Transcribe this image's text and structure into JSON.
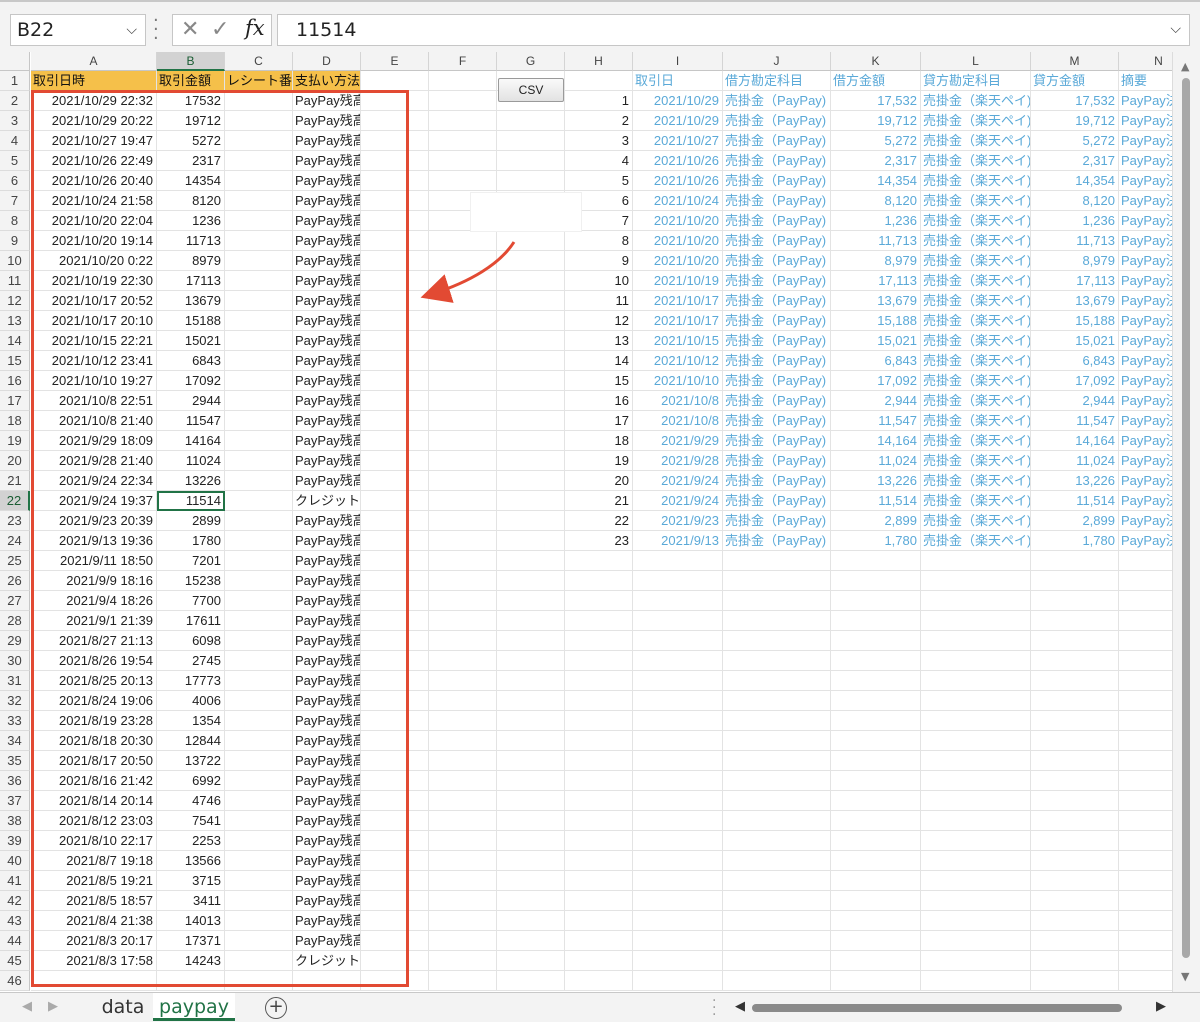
{
  "formula_bar": {
    "name_box": "B22",
    "cancel_glyph": "✕",
    "enter_glyph": "✓",
    "fx_label": "fx",
    "formula_value": "11514"
  },
  "columns": [
    "A",
    "B",
    "C",
    "D",
    "E",
    "F",
    "G",
    "H",
    "I",
    "J",
    "K",
    "L",
    "M",
    "N"
  ],
  "selected_column": "B",
  "row_numbers": [
    1,
    2,
    3,
    4,
    5,
    6,
    7,
    8,
    9,
    10,
    11,
    12,
    13,
    14,
    15,
    16,
    17,
    18,
    19,
    20,
    21,
    22,
    23,
    24,
    25,
    26,
    27,
    28,
    29,
    30,
    31,
    32,
    33,
    34,
    35,
    36,
    37,
    38,
    39,
    40,
    41,
    42,
    43,
    44,
    45,
    46
  ],
  "selected_row": 22,
  "left_table": {
    "headers": [
      "取引日時",
      "取引金額",
      "レシート番",
      "支払い方法"
    ],
    "rows": [
      [
        "2021/10/29 22:32",
        "17532",
        "",
        "PayPay残高"
      ],
      [
        "2021/10/29 20:22",
        "19712",
        "",
        "PayPay残高"
      ],
      [
        "2021/10/27 19:47",
        "5272",
        "",
        "PayPay残高"
      ],
      [
        "2021/10/26 22:49",
        "2317",
        "",
        "PayPay残高"
      ],
      [
        "2021/10/26 20:40",
        "14354",
        "",
        "PayPay残高"
      ],
      [
        "2021/10/24 21:58",
        "8120",
        "",
        "PayPay残高"
      ],
      [
        "2021/10/20 22:04",
        "1236",
        "",
        "PayPay残高"
      ],
      [
        "2021/10/20 19:14",
        "11713",
        "",
        "PayPay残高"
      ],
      [
        "2021/10/20 0:22",
        "8979",
        "",
        "PayPay残高"
      ],
      [
        "2021/10/19 22:30",
        "17113",
        "",
        "PayPay残高"
      ],
      [
        "2021/10/17 20:52",
        "13679",
        "",
        "PayPay残高"
      ],
      [
        "2021/10/17 20:10",
        "15188",
        "",
        "PayPay残高"
      ],
      [
        "2021/10/15 22:21",
        "15021",
        "",
        "PayPay残高"
      ],
      [
        "2021/10/12 23:41",
        "6843",
        "",
        "PayPay残高"
      ],
      [
        "2021/10/10 19:27",
        "17092",
        "",
        "PayPay残高"
      ],
      [
        "2021/10/8 22:51",
        "2944",
        "",
        "PayPay残高"
      ],
      [
        "2021/10/8 21:40",
        "11547",
        "",
        "PayPay残高"
      ],
      [
        "2021/9/29 18:09",
        "14164",
        "",
        "PayPay残高"
      ],
      [
        "2021/9/28 21:40",
        "11024",
        "",
        "PayPay残高"
      ],
      [
        "2021/9/24 22:34",
        "13226",
        "",
        "PayPay残高"
      ],
      [
        "2021/9/24 19:37",
        "11514",
        "",
        "クレジットカード"
      ],
      [
        "2021/9/23 20:39",
        "2899",
        "",
        "PayPay残高"
      ],
      [
        "2021/9/13 19:36",
        "1780",
        "",
        "PayPay残高"
      ],
      [
        "2021/9/11 18:50",
        "7201",
        "",
        "PayPay残高"
      ],
      [
        "2021/9/9 18:16",
        "15238",
        "",
        "PayPay残高"
      ],
      [
        "2021/9/4 18:26",
        "7700",
        "",
        "PayPay残高"
      ],
      [
        "2021/9/1 21:39",
        "17611",
        "",
        "PayPay残高"
      ],
      [
        "2021/8/27 21:13",
        "6098",
        "",
        "PayPay残高"
      ],
      [
        "2021/8/26 19:54",
        "2745",
        "",
        "PayPay残高"
      ],
      [
        "2021/8/25 20:13",
        "17773",
        "",
        "PayPay残高"
      ],
      [
        "2021/8/24 19:06",
        "4006",
        "",
        "PayPay残高"
      ],
      [
        "2021/8/19 23:28",
        "1354",
        "",
        "PayPay残高"
      ],
      [
        "2021/8/18 20:30",
        "12844",
        "",
        "PayPay残高"
      ],
      [
        "2021/8/17 20:50",
        "13722",
        "",
        "PayPay残高"
      ],
      [
        "2021/8/16 21:42",
        "6992",
        "",
        "PayPay残高"
      ],
      [
        "2021/8/14 20:14",
        "4746",
        "",
        "PayPay残高"
      ],
      [
        "2021/8/12 23:03",
        "7541",
        "",
        "PayPay残高"
      ],
      [
        "2021/8/10 22:17",
        "2253",
        "",
        "PayPay残高"
      ],
      [
        "2021/8/7 19:18",
        "13566",
        "",
        "PayPay残高"
      ],
      [
        "2021/8/5 19:21",
        "3715",
        "",
        "PayPay残高"
      ],
      [
        "2021/8/5 18:57",
        "3411",
        "",
        "PayPay残高"
      ],
      [
        "2021/8/4 21:38",
        "14013",
        "",
        "PayPay残高"
      ],
      [
        "2021/8/3 20:17",
        "17371",
        "",
        "PayPay残高"
      ],
      [
        "2021/8/3 17:58",
        "14243",
        "",
        "クレジットカード"
      ]
    ]
  },
  "csv_button_label": "CSV",
  "right_table": {
    "headers": [
      "",
      "取引日",
      "借方勘定科目",
      "借方金額",
      "貸方勘定科目",
      "貸方金額",
      "摘要"
    ],
    "rows": [
      [
        "1",
        "2021/10/29",
        "売掛金（PayPay)",
        "17,532",
        "売掛金（楽天ペイ)",
        "17,532",
        "PayPay決"
      ],
      [
        "2",
        "2021/10/29",
        "売掛金（PayPay)",
        "19,712",
        "売掛金（楽天ペイ)",
        "19,712",
        "PayPay決"
      ],
      [
        "3",
        "2021/10/27",
        "売掛金（PayPay)",
        "5,272",
        "売掛金（楽天ペイ)",
        "5,272",
        "PayPay決"
      ],
      [
        "4",
        "2021/10/26",
        "売掛金（PayPay)",
        "2,317",
        "売掛金（楽天ペイ)",
        "2,317",
        "PayPay決"
      ],
      [
        "5",
        "2021/10/26",
        "売掛金（PayPay)",
        "14,354",
        "売掛金（楽天ペイ)",
        "14,354",
        "PayPay決"
      ],
      [
        "6",
        "2021/10/24",
        "売掛金（PayPay)",
        "8,120",
        "売掛金（楽天ペイ)",
        "8,120",
        "PayPay決"
      ],
      [
        "7",
        "2021/10/20",
        "売掛金（PayPay)",
        "1,236",
        "売掛金（楽天ペイ)",
        "1,236",
        "PayPay決"
      ],
      [
        "8",
        "2021/10/20",
        "売掛金（PayPay)",
        "11,713",
        "売掛金（楽天ペイ)",
        "11,713",
        "PayPay決"
      ],
      [
        "9",
        "2021/10/20",
        "売掛金（PayPay)",
        "8,979",
        "売掛金（楽天ペイ)",
        "8,979",
        "PayPay決"
      ],
      [
        "10",
        "2021/10/19",
        "売掛金（PayPay)",
        "17,113",
        "売掛金（楽天ペイ)",
        "17,113",
        "PayPay決"
      ],
      [
        "11",
        "2021/10/17",
        "売掛金（PayPay)",
        "13,679",
        "売掛金（楽天ペイ)",
        "13,679",
        "PayPay決"
      ],
      [
        "12",
        "2021/10/17",
        "売掛金（PayPay)",
        "15,188",
        "売掛金（楽天ペイ)",
        "15,188",
        "PayPay決"
      ],
      [
        "13",
        "2021/10/15",
        "売掛金（PayPay)",
        "15,021",
        "売掛金（楽天ペイ)",
        "15,021",
        "PayPay決"
      ],
      [
        "14",
        "2021/10/12",
        "売掛金（PayPay)",
        "6,843",
        "売掛金（楽天ペイ)",
        "6,843",
        "PayPay決"
      ],
      [
        "15",
        "2021/10/10",
        "売掛金（PayPay)",
        "17,092",
        "売掛金（楽天ペイ)",
        "17,092",
        "PayPay決"
      ],
      [
        "16",
        "2021/10/8",
        "売掛金（PayPay)",
        "2,944",
        "売掛金（楽天ペイ)",
        "2,944",
        "PayPay決"
      ],
      [
        "17",
        "2021/10/8",
        "売掛金（PayPay)",
        "11,547",
        "売掛金（楽天ペイ)",
        "11,547",
        "PayPay決"
      ],
      [
        "18",
        "2021/9/29",
        "売掛金（PayPay)",
        "14,164",
        "売掛金（楽天ペイ)",
        "14,164",
        "PayPay決"
      ],
      [
        "19",
        "2021/9/28",
        "売掛金（PayPay)",
        "11,024",
        "売掛金（楽天ペイ)",
        "11,024",
        "PayPay決"
      ],
      [
        "20",
        "2021/9/24",
        "売掛金（PayPay)",
        "13,226",
        "売掛金（楽天ペイ)",
        "13,226",
        "PayPay決"
      ],
      [
        "21",
        "2021/9/24",
        "売掛金（PayPay)",
        "11,514",
        "売掛金（楽天ペイ)",
        "11,514",
        "PayPay決"
      ],
      [
        "22",
        "2021/9/23",
        "売掛金（PayPay)",
        "2,899",
        "売掛金（楽天ペイ)",
        "2,899",
        "PayPay決"
      ],
      [
        "23",
        "2021/9/13",
        "売掛金（PayPay)",
        "1,780",
        "売掛金（楽天ペイ)",
        "1,780",
        "PayPay決"
      ]
    ]
  },
  "sheet_tabs": [
    "data",
    "paypay"
  ],
  "active_sheet": "paypay",
  "colors": {
    "accent": "#217346",
    "header_fill": "#f5c04a",
    "linked_text": "#5aa9d8",
    "highlight_border": "#e24a33"
  }
}
